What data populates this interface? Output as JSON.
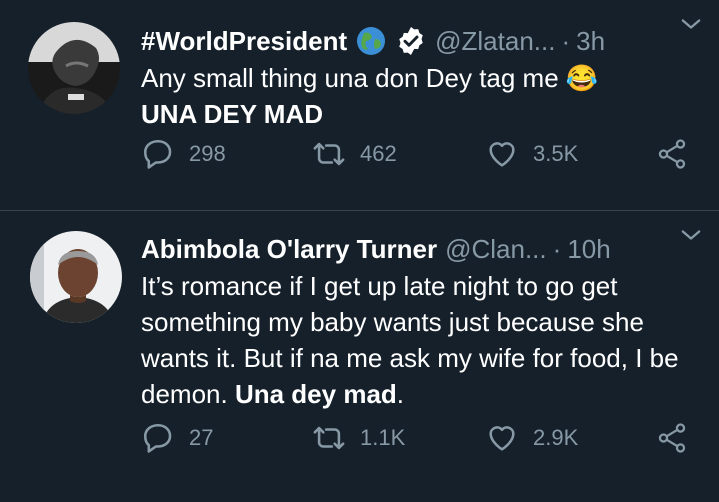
{
  "tweets": [
    {
      "name": "#WorldPresident",
      "handle": "@Zlatan...",
      "dot": "·",
      "time": "3h",
      "text_plain": "Any small thing una don Dey tag me",
      "emoji": "😂",
      "text_bold": "UNA DEY MAD",
      "replies": "298",
      "retweets": "462",
      "likes": "3.5K",
      "badges": [
        "globe-emoji",
        "verified-badge"
      ]
    },
    {
      "name": "Abimbola O'larry Turner",
      "handle": "@Clan...",
      "dot": "·",
      "time": "10h",
      "text_plain": "It’s romance if I get up late night to go get something my baby wants just because she wants it. But if na me ask my wife for food, I be demon. ",
      "text_bold": "Una dey mad",
      "text_tail": ".",
      "replies": "27",
      "retweets": "1.1K",
      "likes": "2.9K"
    }
  ],
  "colors": {
    "background": "#15202b",
    "text": "#ffffff",
    "secondary": "#8899a6",
    "divider": "#38444d"
  }
}
